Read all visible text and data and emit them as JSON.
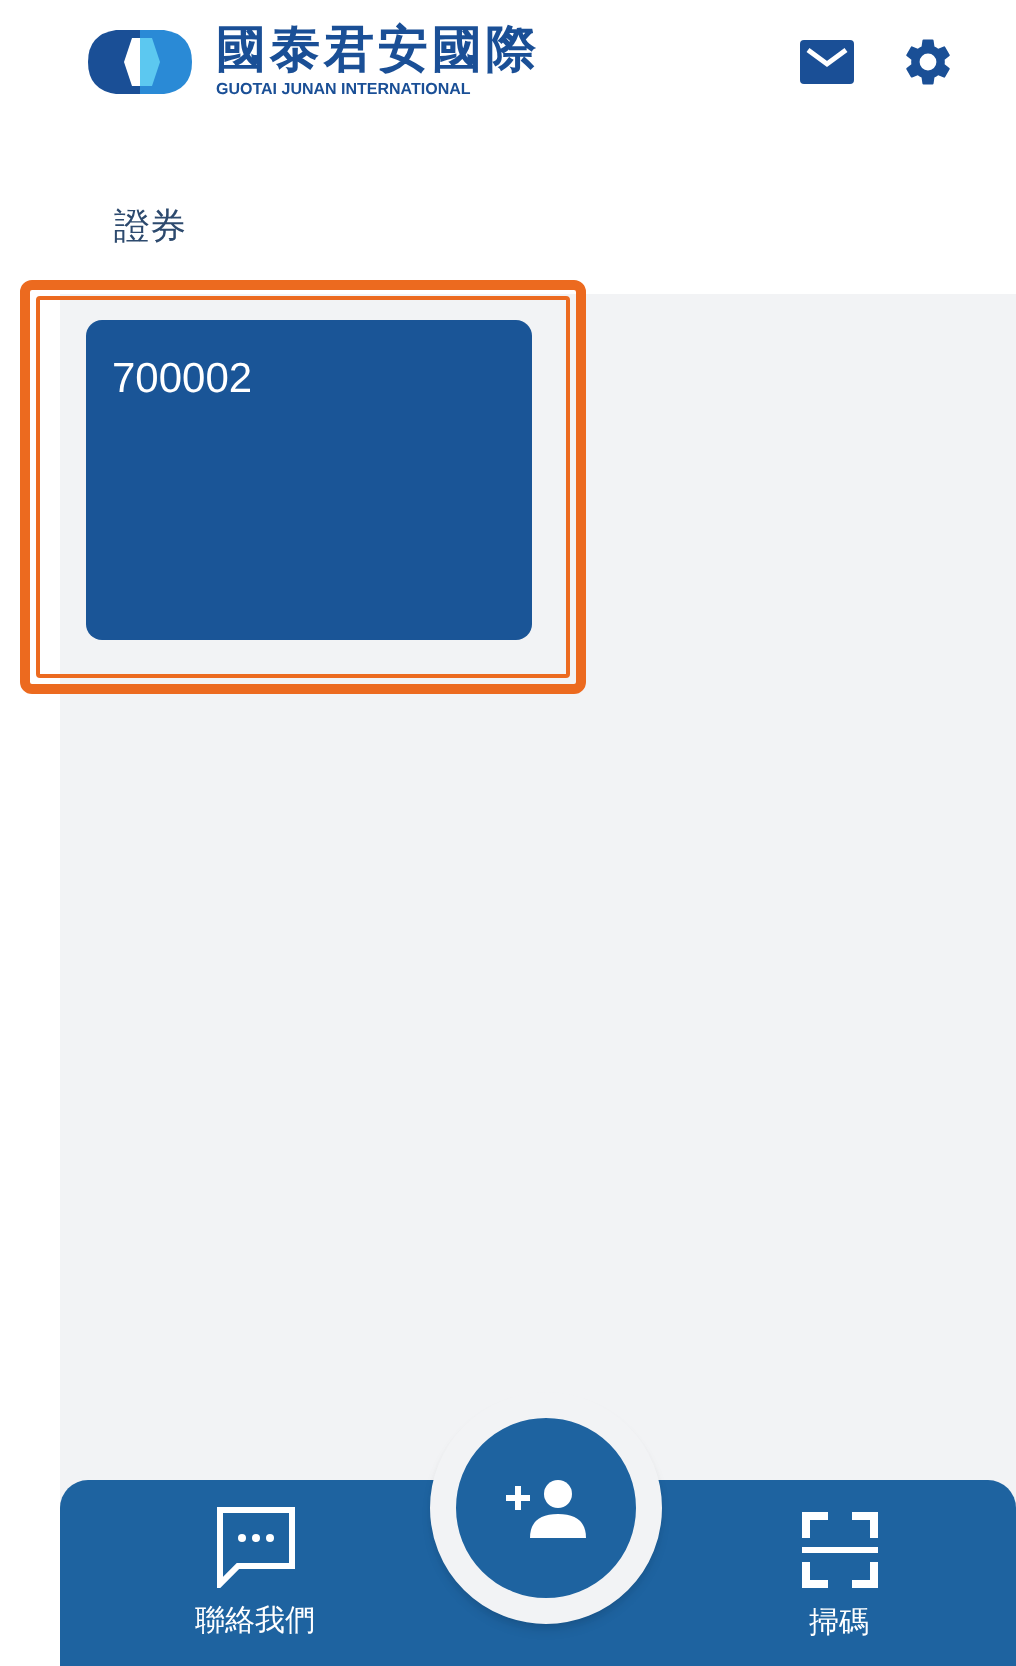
{
  "header": {
    "logo_title": "國泰君安國際",
    "logo_subtitle": "GUOTAI JUNAN INTERNATIONAL"
  },
  "section_title": "證券",
  "accounts": [
    {
      "number": "700002",
      "highlighted": true
    }
  ],
  "bottom_bar": {
    "left": {
      "label": "聯絡我們"
    },
    "right": {
      "label": "掃碼"
    }
  }
}
